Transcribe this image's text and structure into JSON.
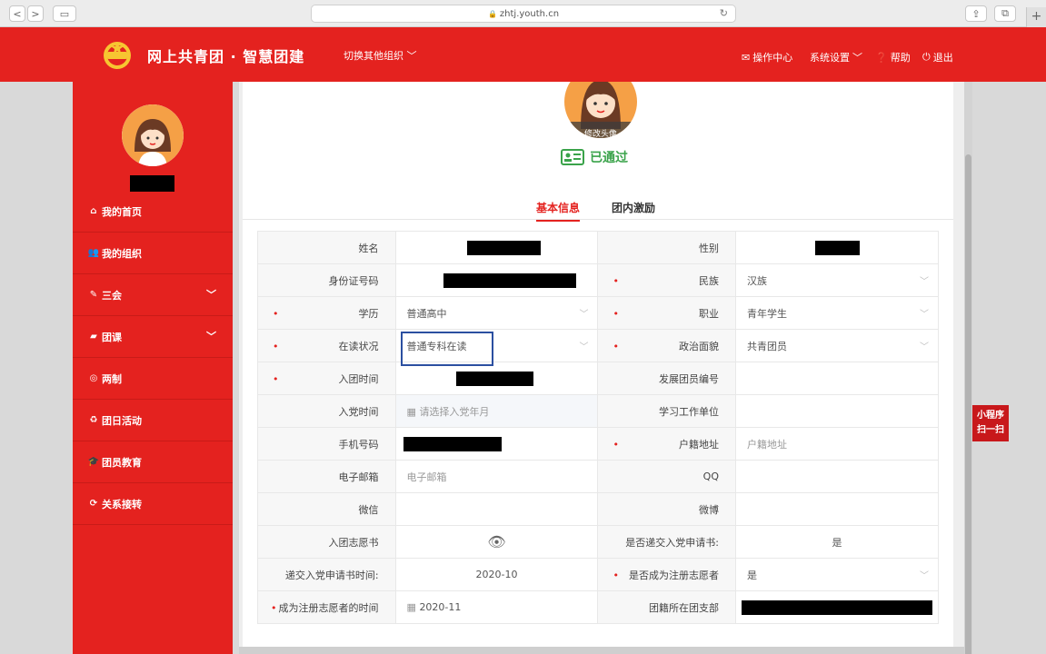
{
  "browser": {
    "url": "zhtj.youth.cn",
    "back": "<",
    "forward": ">",
    "plus": "+"
  },
  "header": {
    "brand": "网上共青团 · 智慧团建",
    "switch_org": "切换其他组织",
    "nav": {
      "ops_center": "操作中心",
      "settings": "系统设置",
      "help": "帮助",
      "logout": "退出"
    }
  },
  "sidebar": {
    "items": [
      {
        "label": "我的首页",
        "icon": "home-icon"
      },
      {
        "label": "我的组织",
        "icon": "users-icon"
      },
      {
        "label": "三会",
        "icon": "edit-icon"
      },
      {
        "label": "团课",
        "icon": "folder-icon"
      },
      {
        "label": "两制",
        "icon": "target-icon"
      },
      {
        "label": "团日活动",
        "icon": "recycle-icon"
      },
      {
        "label": "团员教育",
        "icon": "graduation-cap-icon"
      },
      {
        "label": "关系接转",
        "icon": "refresh-icon"
      }
    ]
  },
  "profile": {
    "change_avatar": "修改头像",
    "status": "已通过"
  },
  "tabs": [
    {
      "label": "基本信息",
      "active": true
    },
    {
      "label": "团内激励",
      "active": false
    }
  ],
  "form": {
    "rows": [
      {
        "l1": "姓名",
        "v1": "",
        "l2": "性别",
        "v2": ""
      },
      {
        "l1": "身份证号码",
        "v1": "",
        "l2": "民族",
        "v2": "汉族"
      },
      {
        "l1": "学历",
        "v1": "普通高中",
        "l2": "职业",
        "v2": "青年学生"
      },
      {
        "l1": "在读状况",
        "v1": "普通专科在读",
        "l2": "政治面貌",
        "v2": "共青团员"
      },
      {
        "l1": "入团时间",
        "v1": "",
        "l2": "发展团员编号",
        "v2": ""
      },
      {
        "l1": "入党时间",
        "v1": "请选择入党年月",
        "l2": "学习工作单位",
        "v2": ""
      },
      {
        "l1": "手机号码",
        "v1": "",
        "l2": "户籍地址",
        "v2": "户籍地址"
      },
      {
        "l1": "电子邮箱",
        "v1": "电子邮箱",
        "l2": "QQ",
        "v2": ""
      },
      {
        "l1": "微信",
        "v1": "",
        "l2": "微博",
        "v2": ""
      },
      {
        "l1": "入团志愿书",
        "v1": "",
        "l2": "是否递交入党申请书:",
        "v2": "是"
      },
      {
        "l1": "递交入党申请书时间:",
        "v1": "2020-10",
        "l2": "是否成为注册志愿者",
        "v2": "是"
      },
      {
        "l1": "成为注册志愿者的时间",
        "v1": "2020-11",
        "l2": "团籍所在团支部",
        "v2": ""
      }
    ]
  },
  "mini_program": {
    "line1": "小程序",
    "line2": "扫一扫"
  }
}
